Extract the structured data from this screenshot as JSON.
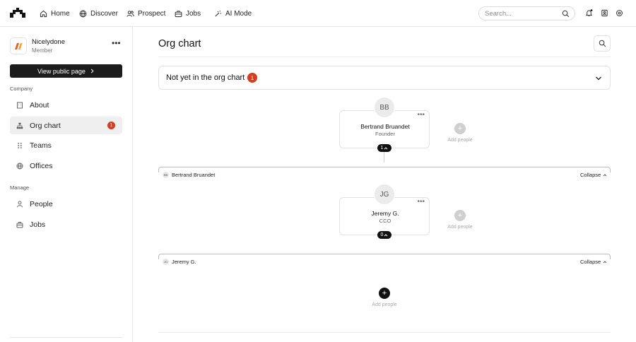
{
  "nav": {
    "items": [
      {
        "label": "Home",
        "icon": "home-icon"
      },
      {
        "label": "Discover",
        "icon": "globe-icon"
      },
      {
        "label": "Prospect",
        "icon": "users-icon"
      },
      {
        "label": "Jobs",
        "icon": "briefcase-icon"
      },
      {
        "label": "AI Mode",
        "icon": "ai-mode-icon"
      }
    ],
    "search_placeholder": "Search..."
  },
  "sidebar": {
    "company_name": "Nicelydone",
    "company_role": "Member",
    "public_button": "View public page",
    "company_section": "Company",
    "company_items": [
      {
        "label": "About",
        "icon": "building-icon"
      },
      {
        "label": "Org chart",
        "icon": "org-chart-icon",
        "badge": "1",
        "active": true
      },
      {
        "label": "Teams",
        "icon": "teams-icon"
      },
      {
        "label": "Offices",
        "icon": "globe-icon"
      }
    ],
    "manage_section": "Manage",
    "manage_items": [
      {
        "label": "People",
        "icon": "person-icon"
      },
      {
        "label": "Jobs",
        "icon": "briefcase-icon"
      }
    ]
  },
  "main": {
    "title": "Org chart",
    "pending": {
      "label": "Not yet in the org chart",
      "count": "1"
    },
    "nodes": [
      {
        "initials": "BB",
        "name": "Bertrand Bruandet",
        "role": "Founder",
        "reports": "1",
        "group_label": "Bertrand Bruandet",
        "add_label": "Add people",
        "collapse_label": "Collapse"
      },
      {
        "initials": "JG",
        "name": "Jeremy G.",
        "role": "CCO",
        "reports": "0",
        "group_label": "Jeremy G.",
        "add_label": "Add people",
        "collapse_label": "Collapse"
      }
    ],
    "bottom_add_label": "Add people"
  },
  "colors": {
    "accent_badge": "#d63c1f",
    "dark": "#111111"
  }
}
